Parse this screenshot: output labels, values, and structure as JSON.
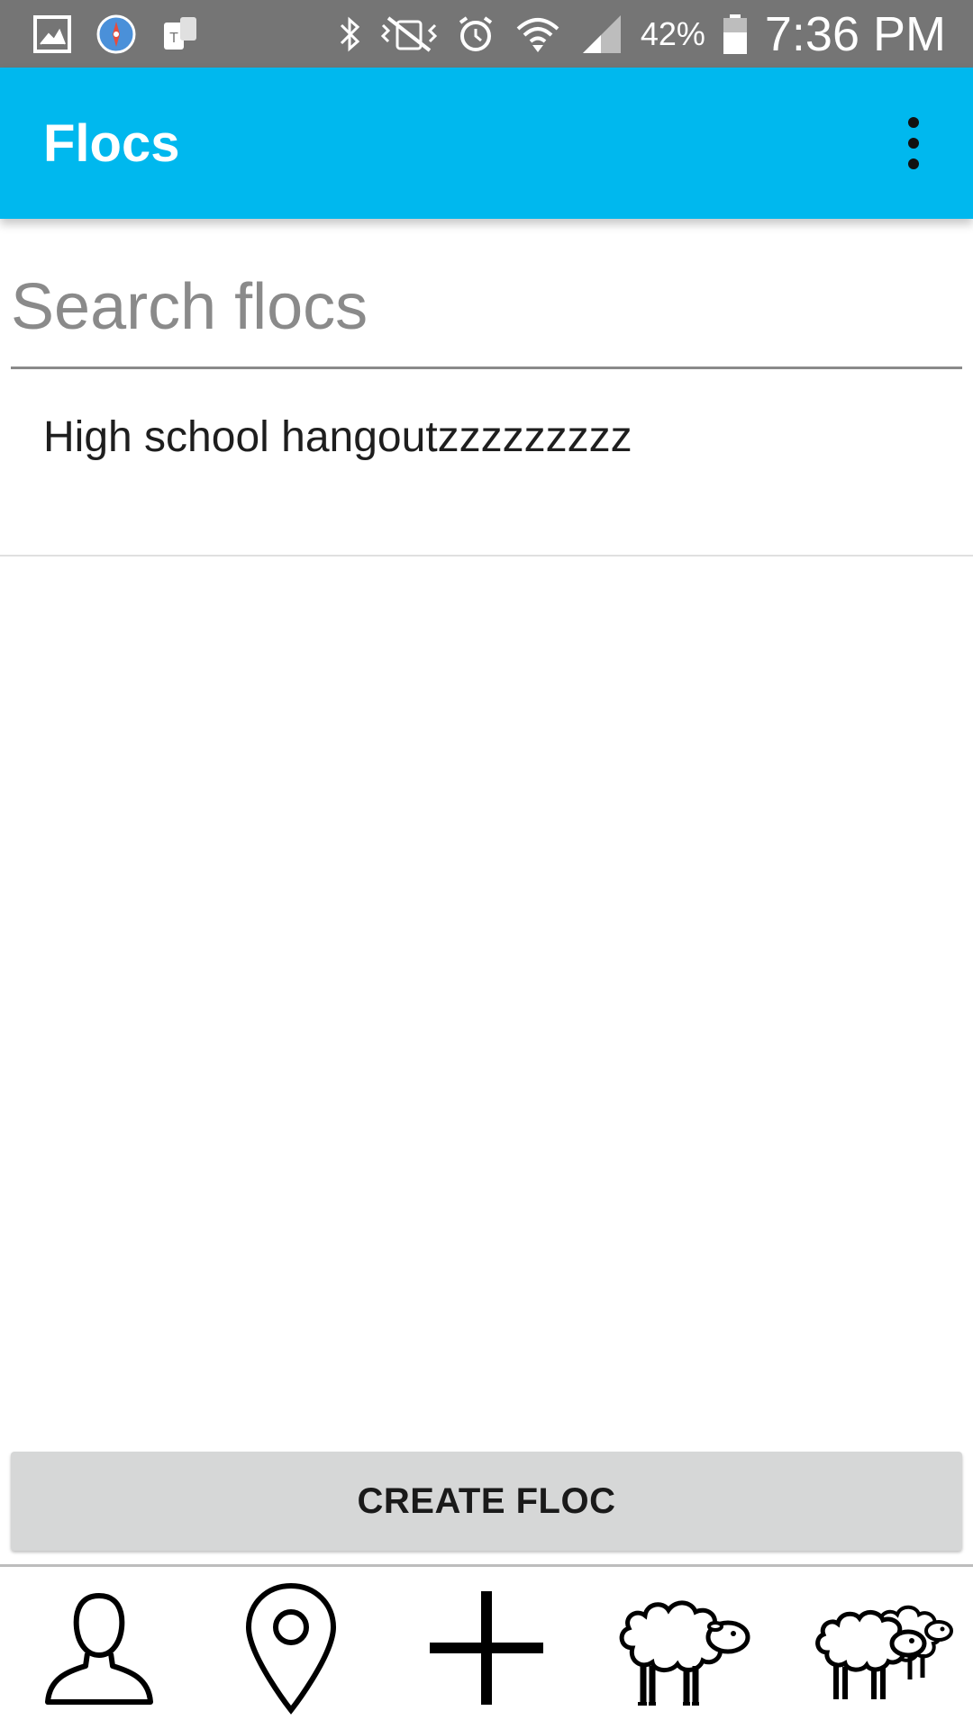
{
  "status_bar": {
    "icons_left": [
      "gallery-icon",
      "compass-icon",
      "tmobile-icon"
    ],
    "icons_right": [
      "bluetooth-icon",
      "vibrate-icon",
      "alarm-icon",
      "wifi-icon",
      "signal-icon"
    ],
    "battery_percent": "42%",
    "time": "7:36 PM"
  },
  "app_bar": {
    "title": "Flocs",
    "background_color": "#00b8ee",
    "menu_icon": "more-vert-icon"
  },
  "search": {
    "placeholder": "Search flocs",
    "value": ""
  },
  "flocs": [
    {
      "name": "High school hangoutzzzzzzzzz"
    }
  ],
  "create_button": {
    "label": "CREATE FLOC"
  },
  "bottom_nav": {
    "items": [
      "profile-icon",
      "location-pin-icon",
      "add-icon",
      "sheep-icon",
      "flock-icon"
    ]
  }
}
